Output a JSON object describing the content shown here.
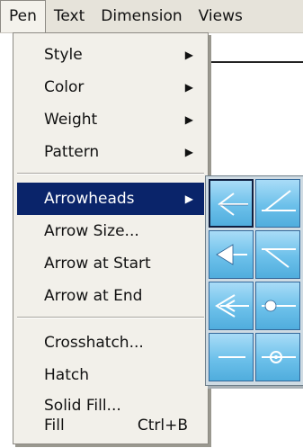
{
  "menubar": {
    "items": [
      {
        "label": "Pen"
      },
      {
        "label": "Text"
      },
      {
        "label": "Dimension"
      },
      {
        "label": "Views"
      }
    ]
  },
  "pen_menu": {
    "items": [
      {
        "label": "Style",
        "submenu": true
      },
      {
        "label": "Color",
        "submenu": true
      },
      {
        "label": "Weight",
        "submenu": true
      },
      {
        "label": "Pattern",
        "submenu": true
      },
      {
        "label": "Arrowheads",
        "submenu": true,
        "highlighted": true
      },
      {
        "label": "Arrow Size..."
      },
      {
        "label": "Arrow at Start"
      },
      {
        "label": "Arrow at End"
      },
      {
        "label": "Crosshatch..."
      },
      {
        "label": "Hatch"
      },
      {
        "label": "Solid Fill..."
      },
      {
        "label": "Fill",
        "shortcut": "Ctrl+B"
      }
    ],
    "submenu_glyph": "▶"
  },
  "arrowhead_palette": {
    "tiles": [
      {
        "icon": "open-arrowhead-icon",
        "selected": true
      },
      {
        "icon": "angled-line-up-icon"
      },
      {
        "icon": "filled-arrowhead-icon"
      },
      {
        "icon": "angled-line-down-icon"
      },
      {
        "icon": "double-line-arrowhead-icon"
      },
      {
        "icon": "dot-end-icon"
      },
      {
        "icon": "plain-line-end-icon"
      },
      {
        "icon": "circle-end-icon"
      }
    ]
  },
  "colors": {
    "highlight": "#0a246a",
    "menu_background": "#f2f0ea",
    "tile_gradient_top": "#a9dcf7",
    "tile_gradient_bottom": "#50addd"
  }
}
